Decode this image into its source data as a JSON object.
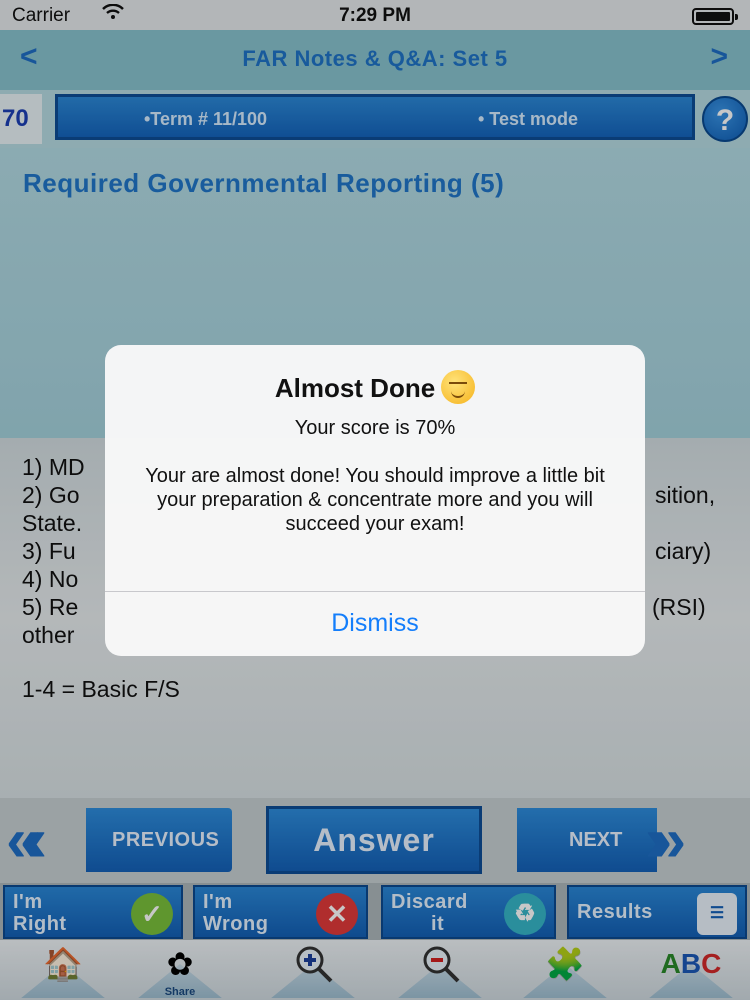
{
  "status_bar": {
    "carrier": "Carrier",
    "time": "7:29 PM"
  },
  "nav": {
    "title": "FAR Notes & Q&A: Set 5",
    "back": "<",
    "forward": ">"
  },
  "info": {
    "score": "70",
    "term": "•Term #  11/100",
    "mode": "• Test mode",
    "help": "?"
  },
  "topic": {
    "title": "Required Governmental Reporting (5)"
  },
  "content": {
    "lines": [
      "1) MD",
      "2)  Go",
      "State.",
      "3) Fu",
      "4) No",
      "5)   Re",
      "other"
    ],
    "right_fragments": [
      "sition,",
      "ciary)",
      "(RSI)"
    ],
    "summary": "1-4 = Basic F/S"
  },
  "buttons": {
    "previous": "PREVIOUS",
    "answer": "Answer",
    "next": "NEXT"
  },
  "actions": {
    "right_line1": "I'm",
    "right_line2": "Right",
    "wrong_line1": "I'm",
    "wrong_line2": "Wrong",
    "discard_line1": "Discard",
    "discard_line2": "it",
    "results": "Results"
  },
  "toolbar": {
    "share": "Share"
  },
  "alert": {
    "title": "Almost Done",
    "score_text": "Your score is 70%",
    "message": "Your are almost done! You should improve a little bit your preparation & concentrate more and you will succeed your exam!",
    "dismiss": "Dismiss"
  },
  "colors": {
    "accent_blue": "#1f74c8",
    "button_blue": "#1461b8",
    "ios_link": "#147efb"
  },
  "icons": [
    "wifi-icon",
    "battery-icon",
    "help-icon",
    "check-icon",
    "x-icon",
    "recycle-icon",
    "results-icon",
    "home-icon",
    "share-icon",
    "zoom-in-icon",
    "zoom-out-icon",
    "puzzle-icon",
    "abc-icon",
    "smirk-emoji-icon"
  ]
}
